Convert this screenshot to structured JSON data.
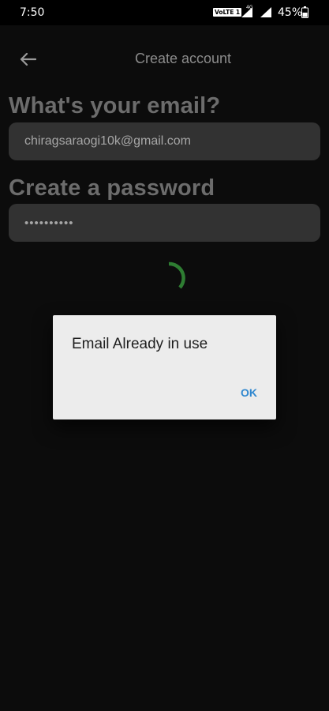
{
  "status_bar": {
    "time": "7:50",
    "volte": "VoLTE 1",
    "network_type": "4G",
    "battery": "45%"
  },
  "app_bar": {
    "back_icon": "arrow-left-icon",
    "title": "Create account"
  },
  "form": {
    "email_heading": "What's your email?",
    "email_value": "chiragsaraogi10k@gmail.com",
    "password_heading": "Create a password",
    "password_value": "••••••••••"
  },
  "loading": {
    "icon": "spinner-icon",
    "color": "#2e7d32"
  },
  "dialog": {
    "message": "Email Already in use",
    "ok_label": "OK"
  },
  "colors": {
    "background": "#0c0c0c",
    "field": "#323232",
    "dialog": "#ececec",
    "ok_accent": "#2f87cf"
  }
}
